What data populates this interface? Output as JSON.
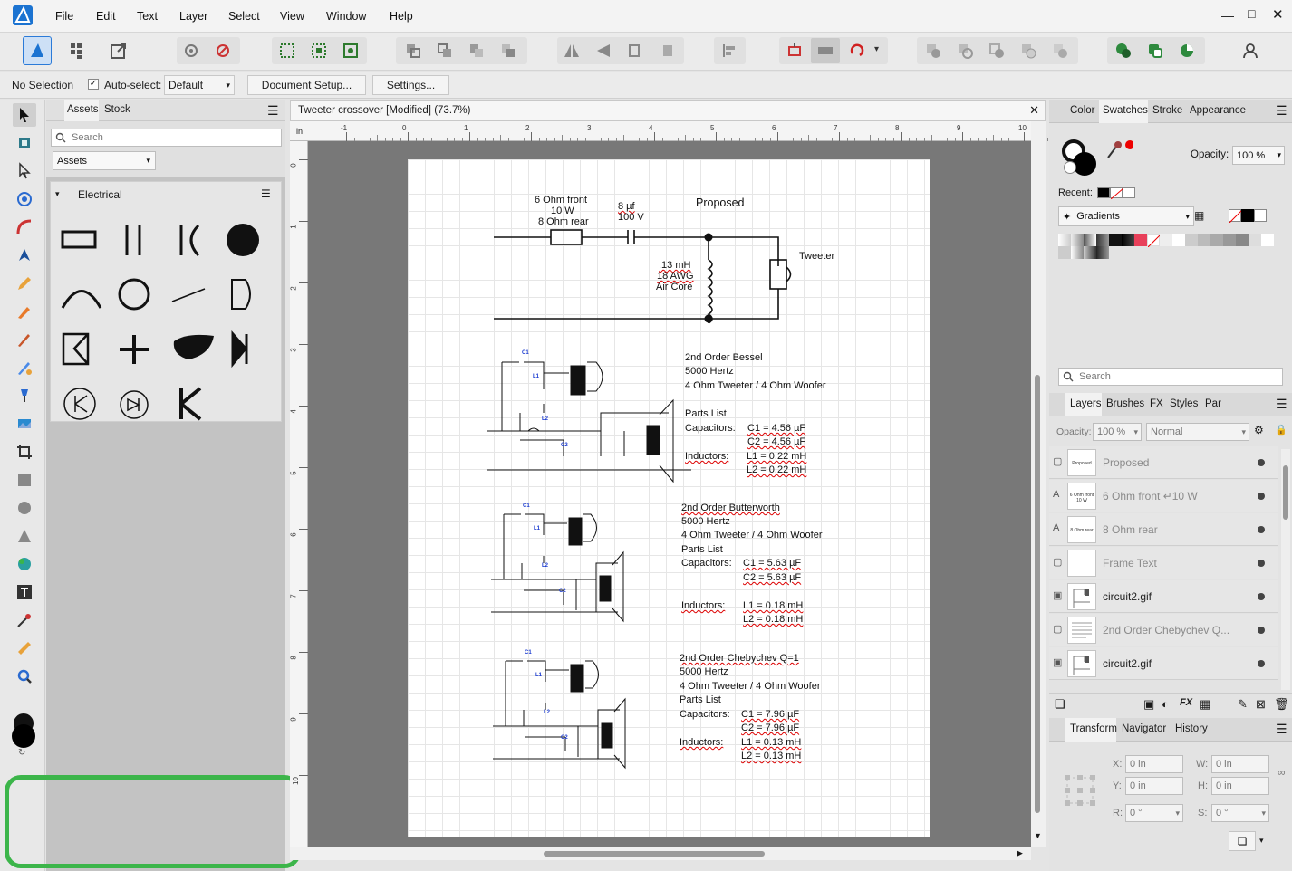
{
  "menu": [
    "File",
    "Edit",
    "Text",
    "Layer",
    "Select",
    "View",
    "Window",
    "Help"
  ],
  "context": {
    "selection": "No Selection",
    "autoselect_label": "Auto-select:",
    "autoselect_value": "Default",
    "doc_setup": "Document Setup...",
    "settings": "Settings..."
  },
  "assets": {
    "tabs": [
      "Assets",
      "Stock"
    ],
    "search_placeholder": "Search",
    "category": "Assets",
    "group": "Electrical"
  },
  "document": {
    "title": "Tweeter crossover [Modified] (73.7%)",
    "ruler_unit": "in",
    "ruler_h": [
      "-1",
      "0",
      "1",
      "2",
      "3",
      "4",
      "5",
      "6",
      "7",
      "8",
      "9",
      "10"
    ],
    "ruler_v": [
      "0",
      "1",
      "2",
      "3",
      "4",
      "5",
      "6",
      "7",
      "8",
      "9",
      "10"
    ]
  },
  "page": {
    "proposed": {
      "title": "Proposed",
      "res_line1": "6 Ohm front",
      "res_line2": "10 W",
      "res_line3": "8 Ohm rear",
      "cap_line1": "8 µf",
      "cap_line2": "100 V",
      "ind_line1": ".13 mH",
      "ind_line2": "18 AWG",
      "ind_line3": "Air Core",
      "tweeter": "Tweeter"
    },
    "bessel": {
      "l1": "2nd Order Bessel",
      "l2": "5000 Hertz",
      "l3": "4 Ohm Tweeter / 4 Ohm Woofer",
      "l4": "Parts List",
      "cap_label": "Capacitors:",
      "c1": "C1 = 4.56 µF",
      "c2": "C2 = 4.56 µF",
      "ind_label": "Inductors:",
      "i1": "L1 = 0.22 mH",
      "i2": "L2 = 0.22 mH"
    },
    "butterworth": {
      "l1": "2nd Order Butterworth",
      "l2": "5000 Hertz",
      "l3": "4 Ohm Tweeter / 4 Ohm Woofer",
      "l4": "Parts List",
      "cap_label": "Capacitors:",
      "c1": "C1 = 5.63 µF",
      "c2": "C2 = 5.63 µF",
      "ind_label": "Inductors:",
      "i1": "L1 = 0.18 mH",
      "i2": "L2 = 0.18 mH"
    },
    "chebychev": {
      "l1": "2nd Order Chebychev Q=1",
      "l2": "5000 Hertz",
      "l3": "4 Ohm Tweeter / 4 Ohm Woofer",
      "l4": "Parts List",
      "cap_label": "Capacitors:",
      "c1": "C1 = 7.96 µF",
      "c2": "C2 = 7.96 µF",
      "ind_label": "Inductors:",
      "i1": "L1 = 0.13 mH",
      "i2": "L2 = 0.13 mH"
    },
    "schem_labels": {
      "c1": "C1",
      "c2": "C2",
      "l1": "L1",
      "l2": "L2"
    }
  },
  "color_panel": {
    "tabs": [
      "Color",
      "Swatches",
      "Stroke",
      "Appearance"
    ],
    "opacity_label": "Opacity:",
    "opacity_value": "100 %",
    "recent_label": "Recent:",
    "palette": "Gradients",
    "search_placeholder": "Search"
  },
  "layers_panel": {
    "tabs": [
      "Layers",
      "Brushes",
      "FX",
      "Styles",
      "Par"
    ],
    "opacity_label": "Opacity:",
    "opacity_value": "100 %",
    "blend_mode": "Normal",
    "layers": [
      {
        "type": "▢",
        "thumb": "Proposed",
        "name": "Proposed",
        "dim": true
      },
      {
        "type": "A",
        "thumb": "6 Ohm front 10 W",
        "name": "6 Ohm front ↵10 W",
        "dim": true
      },
      {
        "type": "A",
        "thumb": "8 Ohm rear",
        "name": "8 Ohm rear",
        "dim": true
      },
      {
        "type": "▢",
        "thumb": "",
        "name": "Frame Text",
        "dim": true
      },
      {
        "type": "▣",
        "thumb": "",
        "name": "circuit2.gif",
        "dim": false
      },
      {
        "type": "▢",
        "thumb": "",
        "name": "2nd Order Chebychev Q...",
        "dim": true
      },
      {
        "type": "▣",
        "thumb": "",
        "name": "circuit2.gif",
        "dim": false
      }
    ]
  },
  "transform_panel": {
    "tabs": [
      "Transform",
      "Navigator",
      "History"
    ],
    "x_label": "X:",
    "x_value": "0 in",
    "y_label": "Y:",
    "y_value": "0 in",
    "w_label": "W:",
    "w_value": "0 in",
    "h_label": "H:",
    "h_value": "0 in",
    "r_label": "R:",
    "r_value": "0 °",
    "s_label": "S:",
    "s_value": "0 °"
  },
  "colors": {
    "accent": "#2a7ad8",
    "highlight": "#3cb54a",
    "toolbar_bg": "#ebebeb"
  }
}
